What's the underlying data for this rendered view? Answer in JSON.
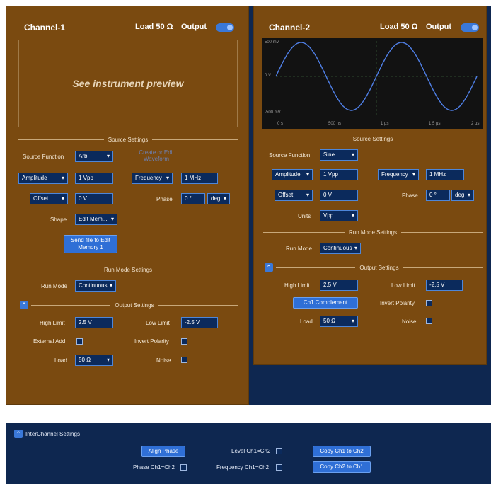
{
  "ch1": {
    "title": "Channel-1",
    "load": "Load 50 Ω",
    "output": "Output",
    "preview": "See instrument preview",
    "source_settings": "Source Settings",
    "source_function_label": "Source Function",
    "source_function": "Arb",
    "create_edit": "Create or Edit Waveform",
    "amplitude": "Amplitude",
    "amplitude_value": "1 Vpp",
    "frequency": "Frequency",
    "frequency_value": "1 MHz",
    "offset": "Offset",
    "offset_value": "0 V",
    "phase_label": "Phase",
    "phase_value": "0 °",
    "phase_unit": "deg",
    "shape_label": "Shape",
    "shape_value": "Edit Mem...",
    "send_file": "Send file to Edit Memory 1",
    "run_mode_settings": "Run Mode Settings",
    "run_mode_label": "Run Mode",
    "run_mode": "Continuous",
    "output_settings": "Output Settings",
    "high_limit_label": "High Limit",
    "high_limit": "2.5 V",
    "low_limit_label": "Low Limit",
    "low_limit": "-2.5 V",
    "external_add": "External Add",
    "invert_polarity": "Invert Polarity",
    "load_label": "Load",
    "load_value": "50 Ω",
    "noise": "Noise"
  },
  "ch2": {
    "title": "Channel-2",
    "load": "Load 50 Ω",
    "output": "Output",
    "plot_y_top": "500 mV",
    "plot_y_mid": "0 V",
    "plot_y_bot": "-500 mV",
    "plot_x": [
      "0 s",
      "500 ns",
      "1 µs",
      "1.5 µs",
      "2 µs"
    ],
    "source_settings": "Source Settings",
    "source_function_label": "Source Function",
    "source_function": "Sine",
    "amplitude": "Amplitude",
    "amplitude_value": "1 Vpp",
    "frequency": "Frequency",
    "frequency_value": "1 MHz",
    "offset": "Offset",
    "offset_value": "0 V",
    "phase_label": "Phase",
    "phase_value": "0 °",
    "phase_unit": "deg",
    "units_label": "Units",
    "units_value": "Vpp",
    "run_mode_settings": "Run Mode Settings",
    "run_mode_label": "Run Mode",
    "run_mode": "Continuous",
    "output_settings": "Output Settings",
    "high_limit_label": "High Limit",
    "high_limit": "2.5 V",
    "low_limit_label": "Low Limit",
    "low_limit": "-2.5 V",
    "ch1_complement": "Ch1 Complement",
    "invert_polarity": "Invert Polarity",
    "load_label": "Load",
    "load_value": "50 Ω",
    "noise": "Noise"
  },
  "inter": {
    "title": "InterChannel Settings",
    "align_phase": "Align Phase",
    "phase_eq": "Phase Ch1=Ch2",
    "level_eq": "Level Ch1=Ch2",
    "freq_eq": "Frequency Ch1=Ch2",
    "copy12": "Copy Ch1 to Ch2",
    "copy21": "Copy Ch2 to Ch1"
  },
  "colors": {
    "panel": "#7a4a10",
    "navy": "#0e2750",
    "accent": "#3a78d8",
    "trace": "#4f7fe6"
  },
  "icons": {
    "collapse": "chevron-up-icon",
    "toggle": "toggle-switch-icon"
  }
}
